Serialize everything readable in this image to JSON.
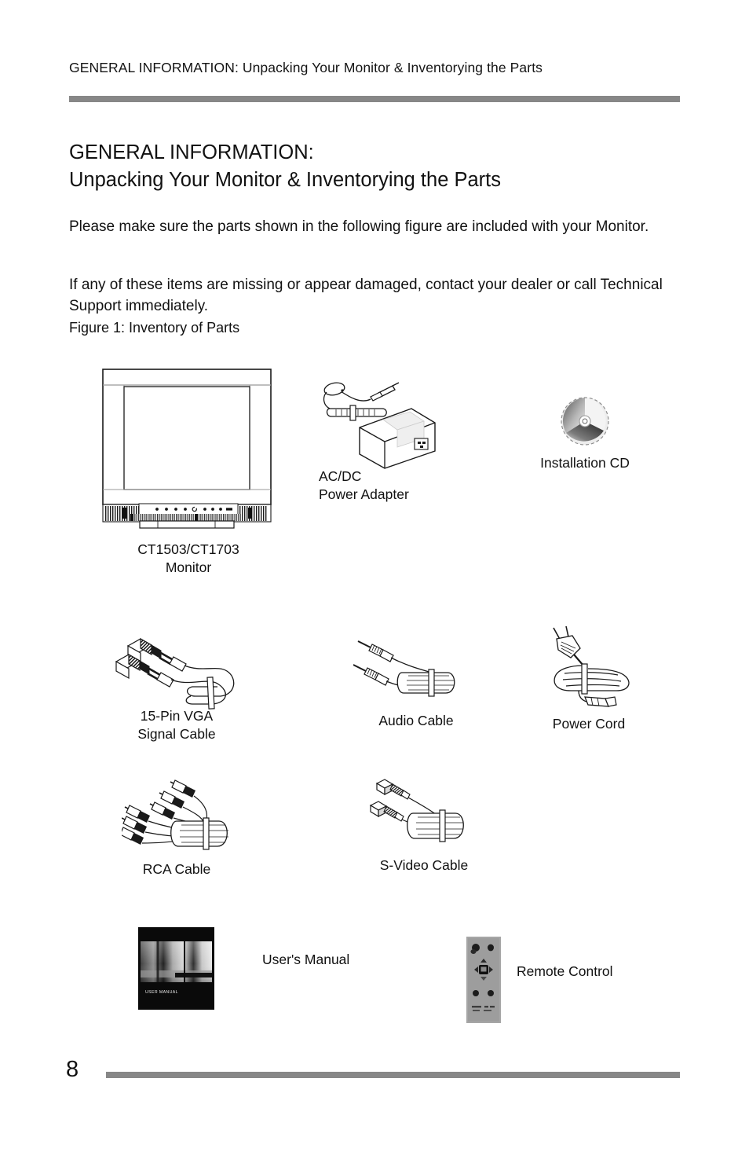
{
  "header": {
    "running_head": "GENERAL INFORMATION: Unpacking Your Monitor & Inventorying the Parts",
    "rule_color": "#878787"
  },
  "title": {
    "line1": "GENERAL INFORMATION:",
    "line2": "Unpacking Your Monitor & Inventorying the Parts"
  },
  "body": {
    "paragraph_1": "Please make sure the parts shown in the following figure are included with your Monitor.",
    "paragraph_2": "If any of these items are missing or appear damaged, contact your dealer or call Technical Support immediately."
  },
  "figure": {
    "caption": "Figure 1: Inventory of Parts",
    "items": [
      {
        "name": "monitor",
        "label": "CT1503/CT1703\nMonitor"
      },
      {
        "name": "power-adapter",
        "label": "AC/DC\nPower Adapter"
      },
      {
        "name": "installation-cd",
        "label": "Installation CD"
      },
      {
        "name": "vga-cable",
        "label": "15-Pin VGA\nSignal Cable"
      },
      {
        "name": "audio-cable",
        "label": "Audio Cable"
      },
      {
        "name": "power-cord",
        "label": "Power Cord"
      },
      {
        "name": "rca-cable",
        "label": "RCA Cable"
      },
      {
        "name": "s-video-cable",
        "label": "S-Video Cable"
      },
      {
        "name": "users-manual",
        "label": "User's Manual"
      },
      {
        "name": "remote-control",
        "label": "Remote Control"
      }
    ],
    "manual_cover_text": "USER MANUAL"
  },
  "footer": {
    "page_number": "8",
    "rule_color": "#878787"
  }
}
